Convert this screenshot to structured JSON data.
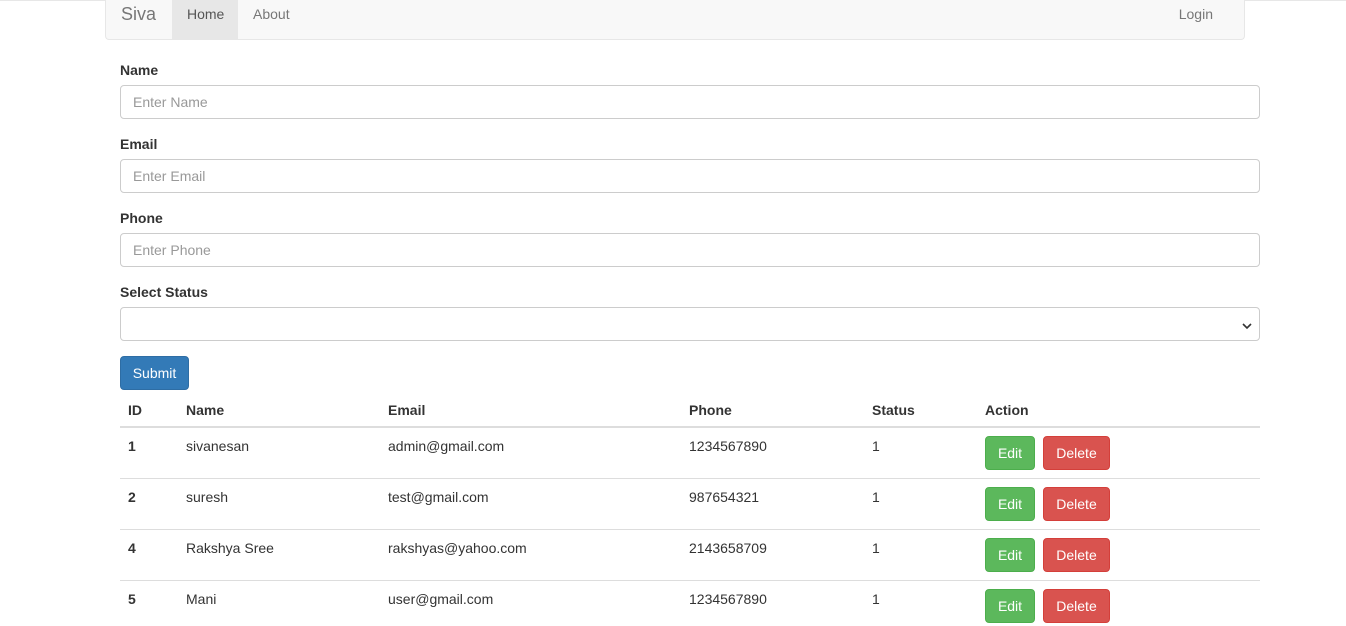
{
  "navbar": {
    "brand": "Siva",
    "items": [
      {
        "label": "Home",
        "active": true
      },
      {
        "label": "About",
        "active": false
      }
    ],
    "login": "Login"
  },
  "form": {
    "name": {
      "label": "Name",
      "placeholder": "Enter Name",
      "value": ""
    },
    "email": {
      "label": "Email",
      "placeholder": "Enter Email",
      "value": ""
    },
    "phone": {
      "label": "Phone",
      "placeholder": "Enter Phone",
      "value": ""
    },
    "status": {
      "label": "Select Status",
      "selected": ""
    },
    "submit_label": "Submit"
  },
  "table": {
    "headers": [
      "ID",
      "Name",
      "Email",
      "Phone",
      "Status",
      "Action"
    ],
    "rows": [
      {
        "id": "1",
        "name": "sivanesan",
        "email": "admin@gmail.com",
        "phone": "1234567890",
        "status": "1"
      },
      {
        "id": "2",
        "name": "suresh",
        "email": "test@gmail.com",
        "phone": "987654321",
        "status": "1"
      },
      {
        "id": "4",
        "name": "Rakshya Sree",
        "email": "rakshyas@yahoo.com",
        "phone": "2143658709",
        "status": "1"
      },
      {
        "id": "5",
        "name": "Mani",
        "email": "user@gmail.com",
        "phone": "1234567890",
        "status": "1"
      }
    ],
    "edit_label": "Edit",
    "delete_label": "Delete"
  },
  "colors": {
    "primary": "#337ab7",
    "success": "#5cb85c",
    "danger": "#d9534f"
  }
}
